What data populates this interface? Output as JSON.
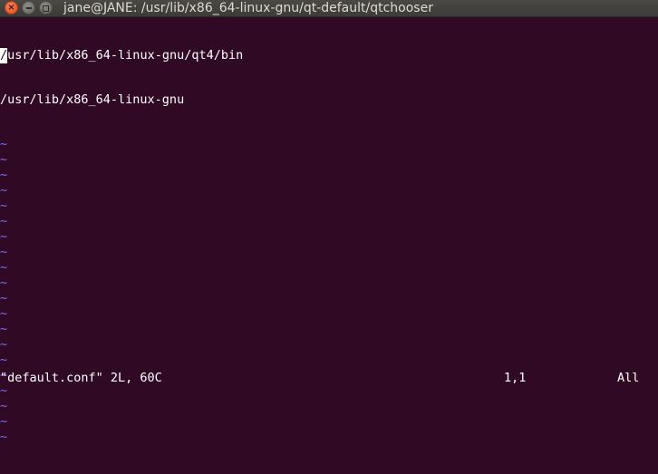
{
  "window": {
    "title": "jane@JANE: /usr/lib/x86_64-linux-gnu/qt-default/qtchooser",
    "close_glyph": "×",
    "colors": {
      "background": "#300a24",
      "text": "#ffffff",
      "tilde": "#7b6ee8",
      "titlebar": "#3c3b37",
      "close": "#e2491a"
    }
  },
  "editor": {
    "cursor_char": "/",
    "lines": [
      {
        "rest": "usr/lib/x86_64-linux-gnu/qt4/bin"
      },
      {
        "text": "/usr/lib/x86_64-linux-gnu"
      }
    ],
    "empty_marker": "~"
  },
  "status": {
    "file_info": "\"default.conf\" 2L, 60C",
    "position": "1,1",
    "view": "All"
  }
}
